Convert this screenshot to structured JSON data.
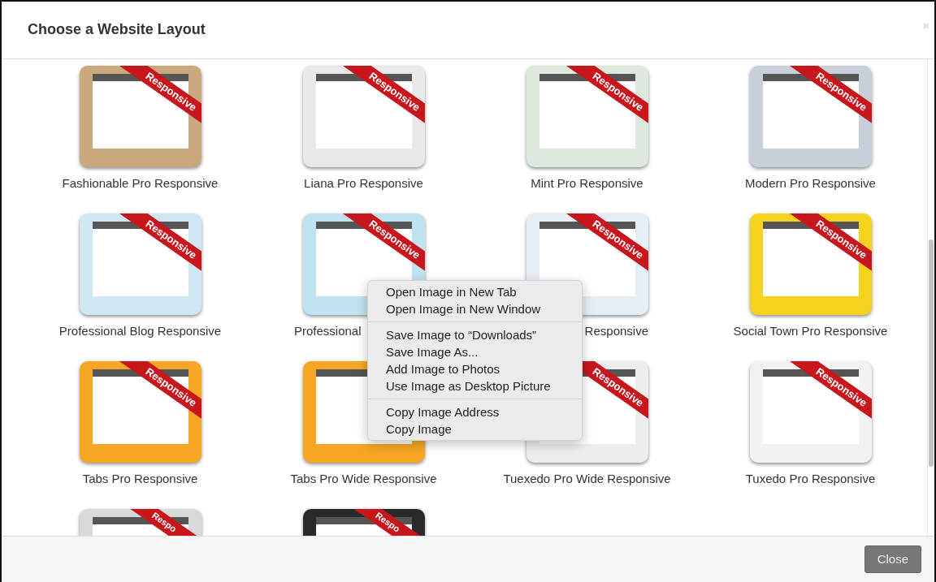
{
  "dialog": {
    "title": "Choose a Website Layout",
    "close_glyph": "×"
  },
  "layouts": [
    {
      "kind": "full",
      "name": "Fashionable Pro Responsive",
      "ribbon": "Responsive",
      "color": "#c9a97c"
    },
    {
      "kind": "full",
      "name": "Liana Pro Responsive",
      "ribbon": "Responsive",
      "color": "#e9e9e9"
    },
    {
      "kind": "full",
      "name": "Mint Pro Responsive",
      "ribbon": "Responsive",
      "color": "#dce9dc"
    },
    {
      "kind": "full",
      "name": "Modern Pro Responsive",
      "ribbon": "Responsive",
      "color": "#c7d0da"
    },
    {
      "kind": "full",
      "name": "Professional Blog Responsive",
      "ribbon": "Responsive",
      "color": "#cfe7f3"
    },
    {
      "kind": "head",
      "name": "Professional",
      "ribbon": "Responsive",
      "color": "#bfe3f0"
    },
    {
      "kind": "tail",
      "name": "Responsive",
      "ribbon": "Responsive",
      "color": "#e6eef5"
    },
    {
      "kind": "full",
      "name": "Social Town Pro Responsive",
      "ribbon": "Responsive",
      "color": "#f5d21c"
    },
    {
      "kind": "full",
      "name": "Tabs Pro Responsive",
      "ribbon": "Responsive",
      "color": "#f6a623"
    },
    {
      "kind": "full",
      "name": "Tabs Pro Wide Responsive",
      "color": "#f6a623"
    },
    {
      "kind": "full",
      "name": "Tuexedo Pro Wide Responsive",
      "ribbon": "Responsive",
      "color": "#ededed"
    },
    {
      "kind": "full",
      "name": "Tuxedo Pro Responsive",
      "ribbon": "Responsive",
      "color": "#f2f2f2"
    },
    {
      "kind": "stub",
      "ribbon": "Respo",
      "color": "#d9d9d9"
    },
    {
      "kind": "stub",
      "ribbon": "Respo",
      "color": "#2a2a2a"
    }
  ],
  "context_menu": {
    "groups": [
      [
        "Open Image in New Tab",
        "Open Image in New Window"
      ],
      [
        "Save Image to “Downloads”",
        "Save Image As...",
        "Add Image to Photos",
        "Use Image as Desktop Picture"
      ],
      [
        "Copy Image Address",
        "Copy Image"
      ]
    ]
  },
  "footer": {
    "buttons": [
      "Close"
    ]
  }
}
